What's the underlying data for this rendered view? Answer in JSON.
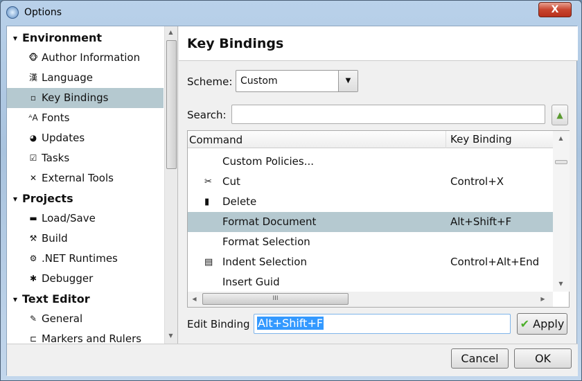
{
  "window": {
    "title": "Options",
    "close_label": "X"
  },
  "sidebar": {
    "items": [
      {
        "label": "Environment",
        "type": "category",
        "icon": "triangle-down-icon"
      },
      {
        "label": "Author Information",
        "icon": "monkey-icon"
      },
      {
        "label": "Language",
        "icon": "kanji-icon"
      },
      {
        "label": "Key Bindings",
        "icon": "keyboard-key-icon",
        "selected": true
      },
      {
        "label": "Fonts",
        "icon": "fonts-icon"
      },
      {
        "label": "Updates",
        "icon": "globe-icon"
      },
      {
        "label": "Tasks",
        "icon": "checklist-icon"
      },
      {
        "label": "External Tools",
        "icon": "tools-icon"
      },
      {
        "label": "Projects",
        "type": "category",
        "icon": "triangle-down-icon"
      },
      {
        "label": "Load/Save",
        "icon": "drive-icon"
      },
      {
        "label": "Build",
        "icon": "hammer-icon"
      },
      {
        "label": ".NET Runtimes",
        "icon": "gear-icon"
      },
      {
        "label": "Debugger",
        "icon": "bug-icon"
      },
      {
        "label": "Text Editor",
        "type": "category",
        "icon": "triangle-down-icon"
      },
      {
        "label": "General",
        "icon": "notepad-icon"
      },
      {
        "label": "Markers and Rulers",
        "icon": "markers-icon"
      }
    ]
  },
  "main": {
    "title": "Key Bindings",
    "scheme_label": "Scheme:",
    "scheme_value": "Custom",
    "search_label": "Search:",
    "search_value": "",
    "columns": [
      "Command",
      "Key Binding"
    ],
    "rows": [
      {
        "command": "Custom Policies...",
        "binding": "",
        "icon": ""
      },
      {
        "command": "Cut",
        "binding": "Control+X",
        "icon": "scissors-icon"
      },
      {
        "command": "Delete",
        "binding": "",
        "icon": "trash-icon"
      },
      {
        "command": "Format Document",
        "binding": "Alt+Shift+F",
        "icon": "",
        "selected": true
      },
      {
        "command": "Format Selection",
        "binding": "",
        "icon": ""
      },
      {
        "command": "Indent Selection",
        "binding": "Control+Alt+End",
        "icon": "indent-icon"
      },
      {
        "command": "Insert Guid",
        "binding": "",
        "icon": ""
      }
    ],
    "edit_binding_label": "Edit Binding",
    "edit_binding_value": "Alt+Shift+F",
    "apply_label": "Apply"
  },
  "footer": {
    "cancel_label": "Cancel",
    "ok_label": "OK"
  },
  "colors": {
    "selection": "#b5c9d0",
    "text_selection": "#3399ff"
  }
}
